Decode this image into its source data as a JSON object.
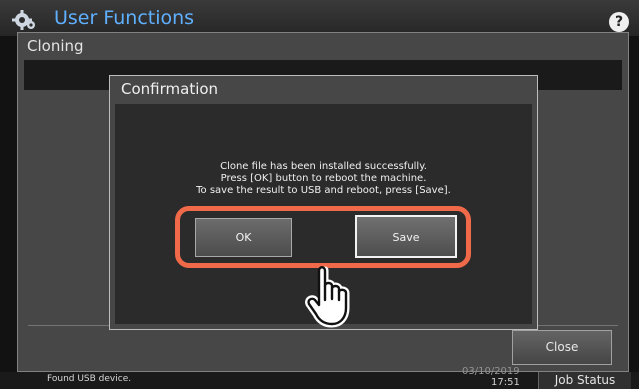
{
  "app": {
    "title": "User Functions",
    "gear_icon": "gear-icon",
    "help_label": "?"
  },
  "window": {
    "title": "Cloning",
    "close_label": "Close"
  },
  "dialog": {
    "title": "Confirmation",
    "message_lines": [
      "Clone file has been installed successfully.",
      "Press [OK] button to reboot the machine.",
      "To save the result to USB and reboot, press [Save]."
    ],
    "ok_label": "OK",
    "save_label": "Save"
  },
  "status_bar": {
    "message": "Found USB device.",
    "date": "03/10/2019",
    "time": "17:51",
    "job_status_label": "Job Status"
  },
  "annotation": {
    "highlight_color": "#f06a4a",
    "pointer_icon": "pointing-hand-icon"
  }
}
